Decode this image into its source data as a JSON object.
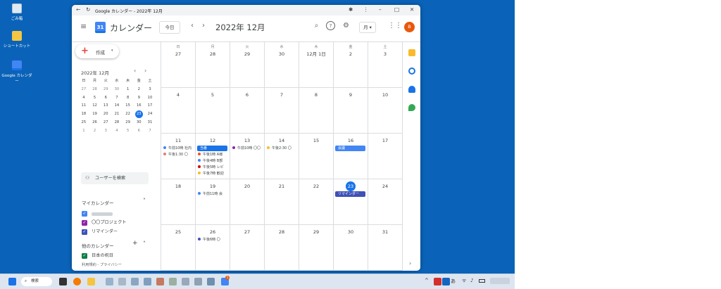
{
  "desktop": {
    "icons": [
      {
        "label": "ごみ箱"
      },
      {
        "label": "ショートカット"
      },
      {
        "label": "Google カレンダー"
      }
    ]
  },
  "taskbar": {
    "search_label": "検索",
    "ime": "あ",
    "badge": "1"
  },
  "window": {
    "title": "Google カレンダー - 2022年 12月"
  },
  "header": {
    "app_title": "カレンダー",
    "logo_day": "31",
    "today_button": "今日",
    "prev": "‹",
    "next": "›",
    "current_month": "2022年 12月",
    "view_select": "月",
    "avatar_initial": "B"
  },
  "sidebar": {
    "create_label": "作成",
    "mini_month": "2022年 12月",
    "mini_weekdays": [
      "日",
      "月",
      "火",
      "水",
      "木",
      "金",
      "土"
    ],
    "mini_weeks": [
      [
        "27",
        "28",
        "29",
        "30",
        "1",
        "2",
        "3"
      ],
      [
        "4",
        "5",
        "6",
        "7",
        "8",
        "9",
        "10"
      ],
      [
        "11",
        "12",
        "13",
        "14",
        "15",
        "16",
        "17"
      ],
      [
        "18",
        "19",
        "20",
        "21",
        "22",
        "23",
        "24"
      ],
      [
        "25",
        "26",
        "27",
        "28",
        "29",
        "30",
        "31"
      ],
      [
        "1",
        "2",
        "3",
        "4",
        "5",
        "6",
        "7"
      ]
    ],
    "search_users": "ユーザーを検索",
    "my_calendars_title": "マイカレンダー",
    "my_calendars": [
      {
        "name": "",
        "color": "#4285f4"
      },
      {
        "name": "〇〇プロジェクト",
        "color": "#8e24aa"
      },
      {
        "name": "リマインダー",
        "color": "#3f51b5"
      }
    ],
    "other_calendars_title": "他のカレンダー",
    "other_calendars": [
      {
        "name": "日本の祝日",
        "color": "#0b8043"
      }
    ],
    "footer": "利用規約 - プライバシー"
  },
  "calendar": {
    "weekdays": [
      "日",
      "月",
      "火",
      "水",
      "木",
      "金",
      "土"
    ],
    "weeks": [
      {
        "days": [
          "27",
          "28",
          "29",
          "30",
          "12月 1日",
          "2",
          "3"
        ]
      },
      {
        "days": [
          "4",
          "5",
          "6",
          "7",
          "8",
          "9",
          "10"
        ]
      },
      {
        "days": [
          "11",
          "12",
          "13",
          "14",
          "15",
          "16",
          "17"
        ]
      },
      {
        "days": [
          "18",
          "19",
          "20",
          "21",
          "22",
          "23",
          "24"
        ]
      },
      {
        "days": [
          "25",
          "26",
          "27",
          "28",
          "29",
          "30",
          "31"
        ]
      }
    ],
    "events": {
      "w2d0": [
        {
          "text": "午前10時 社内",
          "color": "#4285f4"
        },
        {
          "text": "午後1:30 〇",
          "color": "#e67c73"
        }
      ],
      "w2d1": [
        {
          "text": "当番",
          "color": "#1a73e8",
          "bar": true
        },
        {
          "text": "午後1時 A様",
          "color": "#f4511e"
        },
        {
          "text": "午後4時 B部",
          "color": "#4285f4"
        },
        {
          "text": "午後5時 レビ",
          "color": "#d50000"
        },
        {
          "text": "午後7時 歓迎",
          "color": "#f6bf26"
        }
      ],
      "w2d2": [
        {
          "text": "午前10時 〇〇",
          "color": "#8e24aa"
        }
      ],
      "w2d3": [
        {
          "text": "午後2:30 〇",
          "color": "#f6bf26"
        }
      ],
      "w2d5": [
        {
          "text": "会議",
          "color": "#4285f4",
          "bar": true
        }
      ],
      "w3d1": [
        {
          "text": "午前11時 会",
          "color": "#4285f4"
        }
      ],
      "w3d5": [
        {
          "text": "リマインダー",
          "color": "#3f51b5",
          "bar": true
        }
      ],
      "w4d1": [
        {
          "text": "午後6時 〇",
          "color": "#3f51b5"
        }
      ]
    }
  }
}
